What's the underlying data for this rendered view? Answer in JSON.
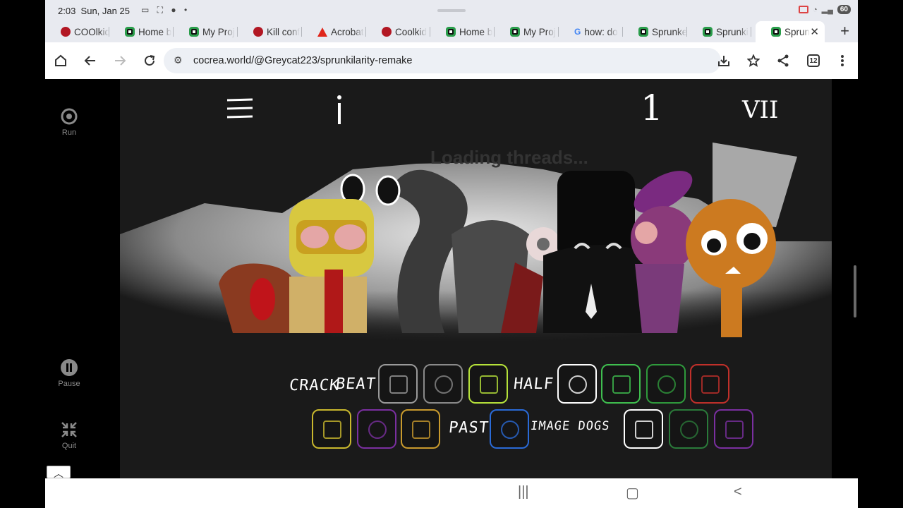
{
  "status": {
    "time": "2:03",
    "date": "Sun, Jan 25",
    "battery": "60"
  },
  "tabs": [
    {
      "label": "COOlkid",
      "favicon": "red-dot-icon"
    },
    {
      "label": "Home b",
      "favicon": "cocrea-icon"
    },
    {
      "label": "My Proj",
      "favicon": "cocrea-icon"
    },
    {
      "label": "Kill conf",
      "favicon": "red-dot-icon"
    },
    {
      "label": "Acrobat",
      "favicon": "acrobat-icon"
    },
    {
      "label": "Coolkid",
      "favicon": "red-dot-icon"
    },
    {
      "label": "Home b",
      "favicon": "cocrea-icon"
    },
    {
      "label": "My Proj",
      "favicon": "cocrea-icon"
    },
    {
      "label": "how: do",
      "favicon": "google-icon"
    },
    {
      "label": "Sprunke",
      "favicon": "cocrea-icon"
    },
    {
      "label": "Sprunki",
      "favicon": "cocrea-icon"
    },
    {
      "label": "Sprun",
      "favicon": "cocrea-icon",
      "active": true
    }
  ],
  "toolbar": {
    "url": "cocrea.world/@Greycat223/sprunkilarity-remake",
    "tab_count": "12"
  },
  "sidebar": {
    "run_label": "Run",
    "pause_label": "Pause",
    "quit_label": "Quit"
  },
  "game": {
    "counter": "1",
    "level_label": "VII",
    "loading_text": "Loading threads...",
    "palette_row1_text": [
      "CRACK",
      "BEAT",
      "HALF"
    ],
    "palette_row2_text": [
      "PAST",
      "IMAGE DOGS"
    ],
    "palette_row1_icons": [
      {
        "name": "microphone-sound-icon",
        "color": "#9a9a9a"
      },
      {
        "name": "crossed-lines-sound-icon",
        "color": "#8a8a8a"
      },
      {
        "name": "candles-sound-icon",
        "color": "#b6e23a"
      },
      {
        "name": "hat-sound-icon",
        "color": "#ffffff"
      },
      {
        "name": "flower-sound-icon",
        "color": "#3fbf4f"
      },
      {
        "name": "flame-sound-icon",
        "color": "#2f9a3c"
      },
      {
        "name": "wave-sound-icon",
        "color": "#c0302a"
      }
    ],
    "palette_row2_icons": [
      {
        "name": "eye-sound-icon",
        "color": "#c9b82d"
      },
      {
        "name": "horns-sound-icon",
        "color": "#7a2fa0"
      },
      {
        "name": "cap-sound-icon",
        "color": "#c99a2d"
      },
      {
        "name": "swirl-sound-icon",
        "color": "#2a6ad6"
      },
      {
        "name": "diamond-sound-icon",
        "color": "#ffffff"
      },
      {
        "name": "tree-sound-icon",
        "color": "#2a7a3a"
      },
      {
        "name": "head-sound-icon",
        "color": "#7a2fa0"
      }
    ]
  },
  "colors": {
    "accent": "#1a73e8",
    "stage_bg": "#1a1a1a"
  }
}
